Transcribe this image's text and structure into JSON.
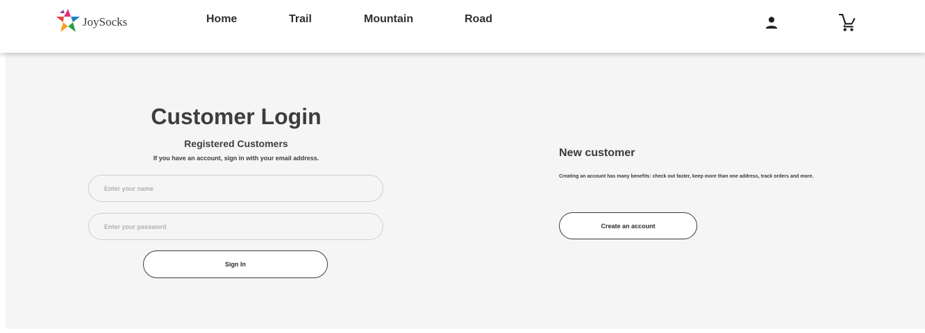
{
  "brand": {
    "name": "JoySocks",
    "logo_colors": [
      "#e8413a",
      "#f7a21b",
      "#2a9d4a",
      "#1d7fc1",
      "#8a3f9a",
      "#e0307a"
    ]
  },
  "nav": {
    "items": [
      {
        "label": "Home"
      },
      {
        "label": "Trail"
      },
      {
        "label": "Mountain"
      },
      {
        "label": "Road"
      }
    ],
    "account_icon": "user-icon",
    "cart_icon": "cart-icon"
  },
  "login": {
    "title": "Customer Login",
    "subtitle": "Registered Customers",
    "hint": "If you have an account, sign in with your email address.",
    "name_placeholder": "Enter your name",
    "password_placeholder": "Enter your password",
    "sign_in_label": "Sign In"
  },
  "new_customer": {
    "title": "New customer",
    "description": "Creating an account has many benefits: check out faster, keep more than one address, track orders and more.",
    "create_label": "Create an account"
  },
  "colors": {
    "page_bg": "#f4f5f4",
    "text": "#3a3a3a",
    "button_border": "#3a3a3a"
  }
}
